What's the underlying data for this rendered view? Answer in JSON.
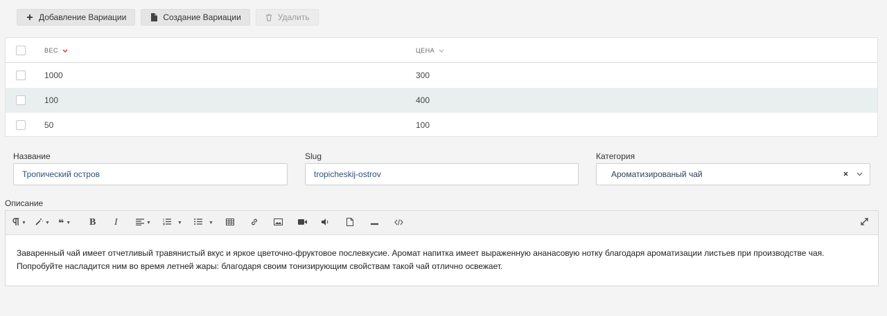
{
  "toolbar": {
    "add_variation": "Добавление Вариации",
    "create_variation": "Создание Вариации",
    "delete": "Удалить"
  },
  "table": {
    "columns": {
      "weight": "ВЕС",
      "price": "ЦЕНА"
    },
    "rows": [
      {
        "weight": "1000",
        "price": "300"
      },
      {
        "weight": "100",
        "price": "400"
      },
      {
        "weight": "50",
        "price": "100"
      }
    ]
  },
  "form": {
    "name_label": "Название",
    "name_value": "Тропический остров",
    "slug_label": "Slug",
    "slug_value": "tropicheskij-ostrov",
    "category_label": "Категория",
    "category_value": "Ароматизированый чай",
    "description_label": "Описание",
    "description_text": "Заваренный чай имеет отчетливый травянистый вкус и яркое цветочно-фруктовое послевкусие. Аромат напитка имеет выраженную ананасовую нотку благодаря ароматизации листьев при производстве чая. Попробуйте насладится ним во время летней жары: благодаря своим тонизирующим свойствам такой чай отлично освежает."
  },
  "colors": {
    "accent_sort": "#d0342c",
    "highlight_row": "#e9efee"
  }
}
